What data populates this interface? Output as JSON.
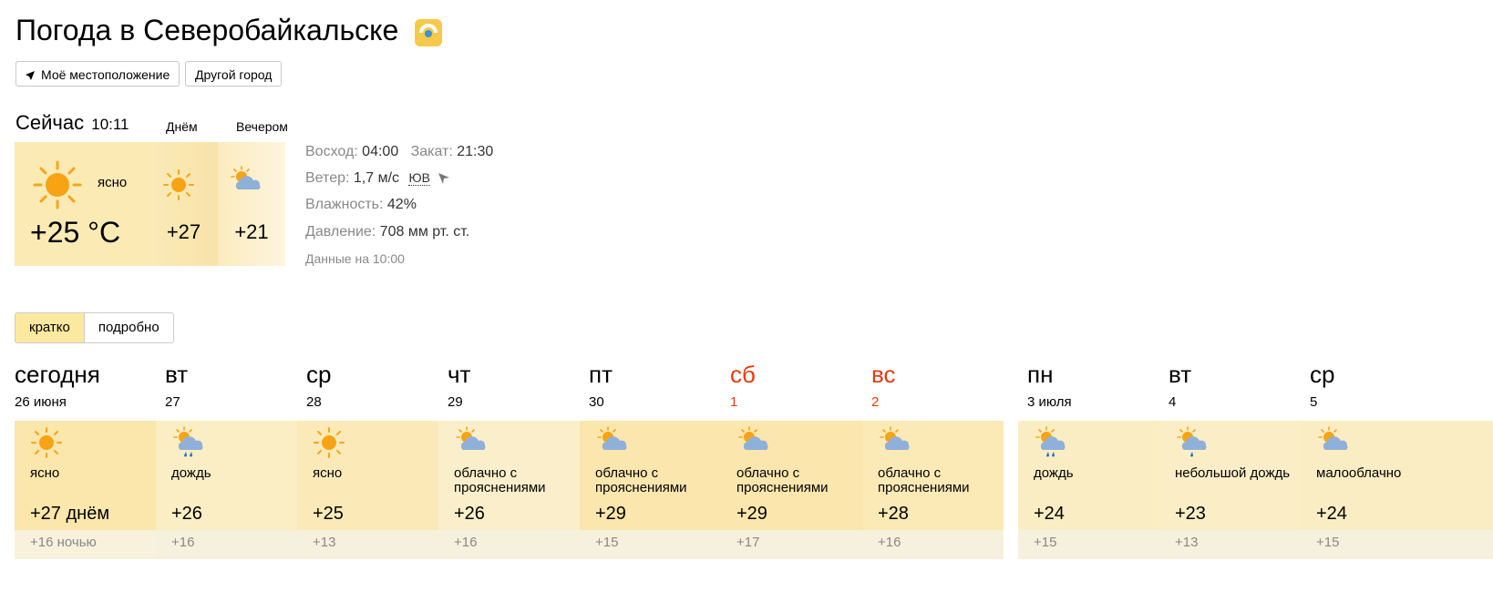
{
  "header": {
    "title": "Погода в Северобайкальске",
    "buttons": {
      "my_location": "Моё местоположение",
      "other_city": "Другой город"
    }
  },
  "now": {
    "label": "Сейчас",
    "time": "10:11",
    "condition": "ясно",
    "temp": "+25 °C",
    "icon": "sun-icon"
  },
  "later": {
    "day_label": "Днём",
    "day_temp": "+27",
    "day_icon": "sun-icon",
    "evening_label": "Вечером",
    "evening_temp": "+21",
    "evening_icon": "partly-cloudy-icon"
  },
  "details": {
    "sunrise_label": "Восход:",
    "sunrise": "04:00",
    "sunset_label": "Закат:",
    "sunset": "21:30",
    "wind_label": "Ветер:",
    "wind": "1,7 м/с",
    "wind_dir": "ЮВ",
    "humidity_label": "Влажность:",
    "humidity": "42%",
    "pressure_label": "Давление:",
    "pressure": "708 мм рт. ст.",
    "data_time": "Данные на 10:00"
  },
  "view_toggle": {
    "short": "кратко",
    "detailed": "подробно",
    "active": "short"
  },
  "forecast": [
    {
      "day": "сегодня",
      "date": "26 июня",
      "icon": "sun-icon",
      "condition": "ясно",
      "day_temp": "+27 днём",
      "night_temp": "+16 ночью",
      "weekend": false
    },
    {
      "day": "вт",
      "date": "27",
      "icon": "sun-rain-icon",
      "condition": "дождь",
      "day_temp": "+26",
      "night_temp": "+16",
      "weekend": false
    },
    {
      "day": "ср",
      "date": "28",
      "icon": "sun-icon",
      "condition": "ясно",
      "day_temp": "+25",
      "night_temp": "+13",
      "weekend": false
    },
    {
      "day": "чт",
      "date": "29",
      "icon": "partly-cloudy-icon",
      "condition": "облачно с прояснениями",
      "day_temp": "+26",
      "night_temp": "+16",
      "weekend": false
    },
    {
      "day": "пт",
      "date": "30",
      "icon": "partly-cloudy-icon",
      "condition": "облачно с прояснениями",
      "day_temp": "+29",
      "night_temp": "+15",
      "weekend": false
    },
    {
      "day": "сб",
      "date": "1",
      "icon": "partly-cloudy-icon",
      "condition": "облачно с прояснениями",
      "day_temp": "+29",
      "night_temp": "+17",
      "weekend": true
    },
    {
      "day": "вс",
      "date": "2",
      "icon": "partly-cloudy-icon",
      "condition": "облачно с прояснениями",
      "day_temp": "+28",
      "night_temp": "+16",
      "weekend": true
    },
    {
      "day": "пн",
      "date": "3 июля",
      "icon": "cloud-rain-icon",
      "condition": "дождь",
      "day_temp": "+24",
      "night_temp": "+15",
      "weekend": false
    },
    {
      "day": "вт",
      "date": "4",
      "icon": "cloud-light-rain-icon",
      "condition": "небольшой дождь",
      "day_temp": "+23",
      "night_temp": "+13",
      "weekend": false
    },
    {
      "day": "ср",
      "date": "5",
      "icon": "partly-cloudy-icon",
      "condition": "малооблачно",
      "day_temp": "+24",
      "night_temp": "+15",
      "weekend": false
    }
  ]
}
